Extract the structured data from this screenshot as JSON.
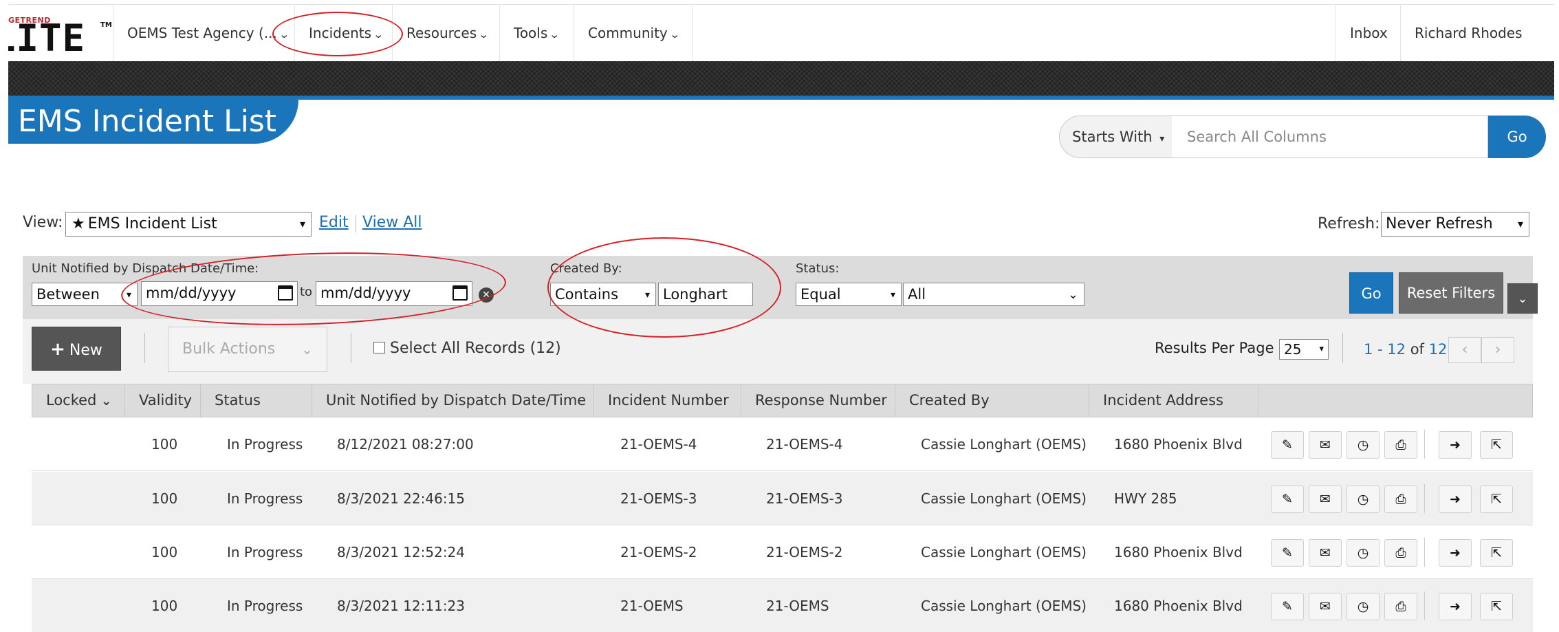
{
  "nav": {
    "logo_top": "GETREND",
    "logo_main": "LITE",
    "logo_tm": "TM",
    "items": [
      {
        "label": "OEMS Test Agency (..."
      },
      {
        "label": "Incidents"
      },
      {
        "label": "Resources"
      },
      {
        "label": "Tools"
      },
      {
        "label": "Community"
      }
    ],
    "inbox": "Inbox",
    "user": "Richard Rhodes"
  },
  "page_title": "EMS Incident List",
  "search": {
    "mode": "Starts With",
    "placeholder": "Search All Columns",
    "go_label": "Go"
  },
  "view": {
    "label": "View:",
    "selected": "EMS Incident List",
    "edit_label": "Edit",
    "view_all_label": "View All"
  },
  "refresh": {
    "label": "Refresh:",
    "selected": "Never Refresh"
  },
  "filters": {
    "date_label": "Unit Notified by Dispatch Date/Time:",
    "date_operator": "Between",
    "date_from_placeholder": "mm/dd/yyyy",
    "date_to_text": "to",
    "date_to_placeholder": "mm/dd/yyyy",
    "created_by_label": "Created By:",
    "created_by_operator": "Contains",
    "created_by_value": "Longhart",
    "status_label": "Status:",
    "status_operator": "Equal",
    "status_value": "All",
    "go_label": "Go",
    "reset_label": "Reset Filters"
  },
  "actions": {
    "new_label": "New",
    "bulk_label": "Bulk Actions",
    "select_all_label": "Select All Records (12)",
    "results_per_page_label": "Results Per Page",
    "results_per_page": "25",
    "pager_range": "1 - 12",
    "pager_of": "of",
    "pager_total": "12"
  },
  "table": {
    "headers": [
      "Locked",
      "Validity",
      "Status",
      "Unit Notified by Dispatch Date/Time",
      "Incident Number",
      "Response Number",
      "Created By",
      "Incident Address"
    ],
    "rows": [
      [
        "",
        "100",
        "In Progress",
        "8/12/2021 08:27:00",
        "21-OEMS-4",
        "21-OEMS-4",
        "Cassie Longhart (OEMS)",
        "1680 Phoenix Blvd"
      ],
      [
        "",
        "100",
        "In Progress",
        "8/3/2021 22:46:15",
        "21-OEMS-3",
        "21-OEMS-3",
        "Cassie Longhart (OEMS)",
        "HWY 285"
      ],
      [
        "",
        "100",
        "In Progress",
        "8/3/2021 12:52:24",
        "21-OEMS-2",
        "21-OEMS-2",
        "Cassie Longhart (OEMS)",
        "1680 Phoenix Blvd"
      ],
      [
        "",
        "100",
        "In Progress",
        "8/3/2021 12:11:23",
        "21-OEMS",
        "21-OEMS",
        "Cassie Longhart (OEMS)",
        "1680 Phoenix Blvd"
      ]
    ],
    "row_icons": [
      "paperclip-icon",
      "envelope-icon",
      "clock-icon",
      "printer-icon",
      "arrow-right-icon",
      "external-link-icon"
    ]
  },
  "colors": {
    "primary_blue": "#1a75bb",
    "annotation_red": "#d42027",
    "dark_band": "#2c2c2c",
    "button_gray": "#555555"
  }
}
